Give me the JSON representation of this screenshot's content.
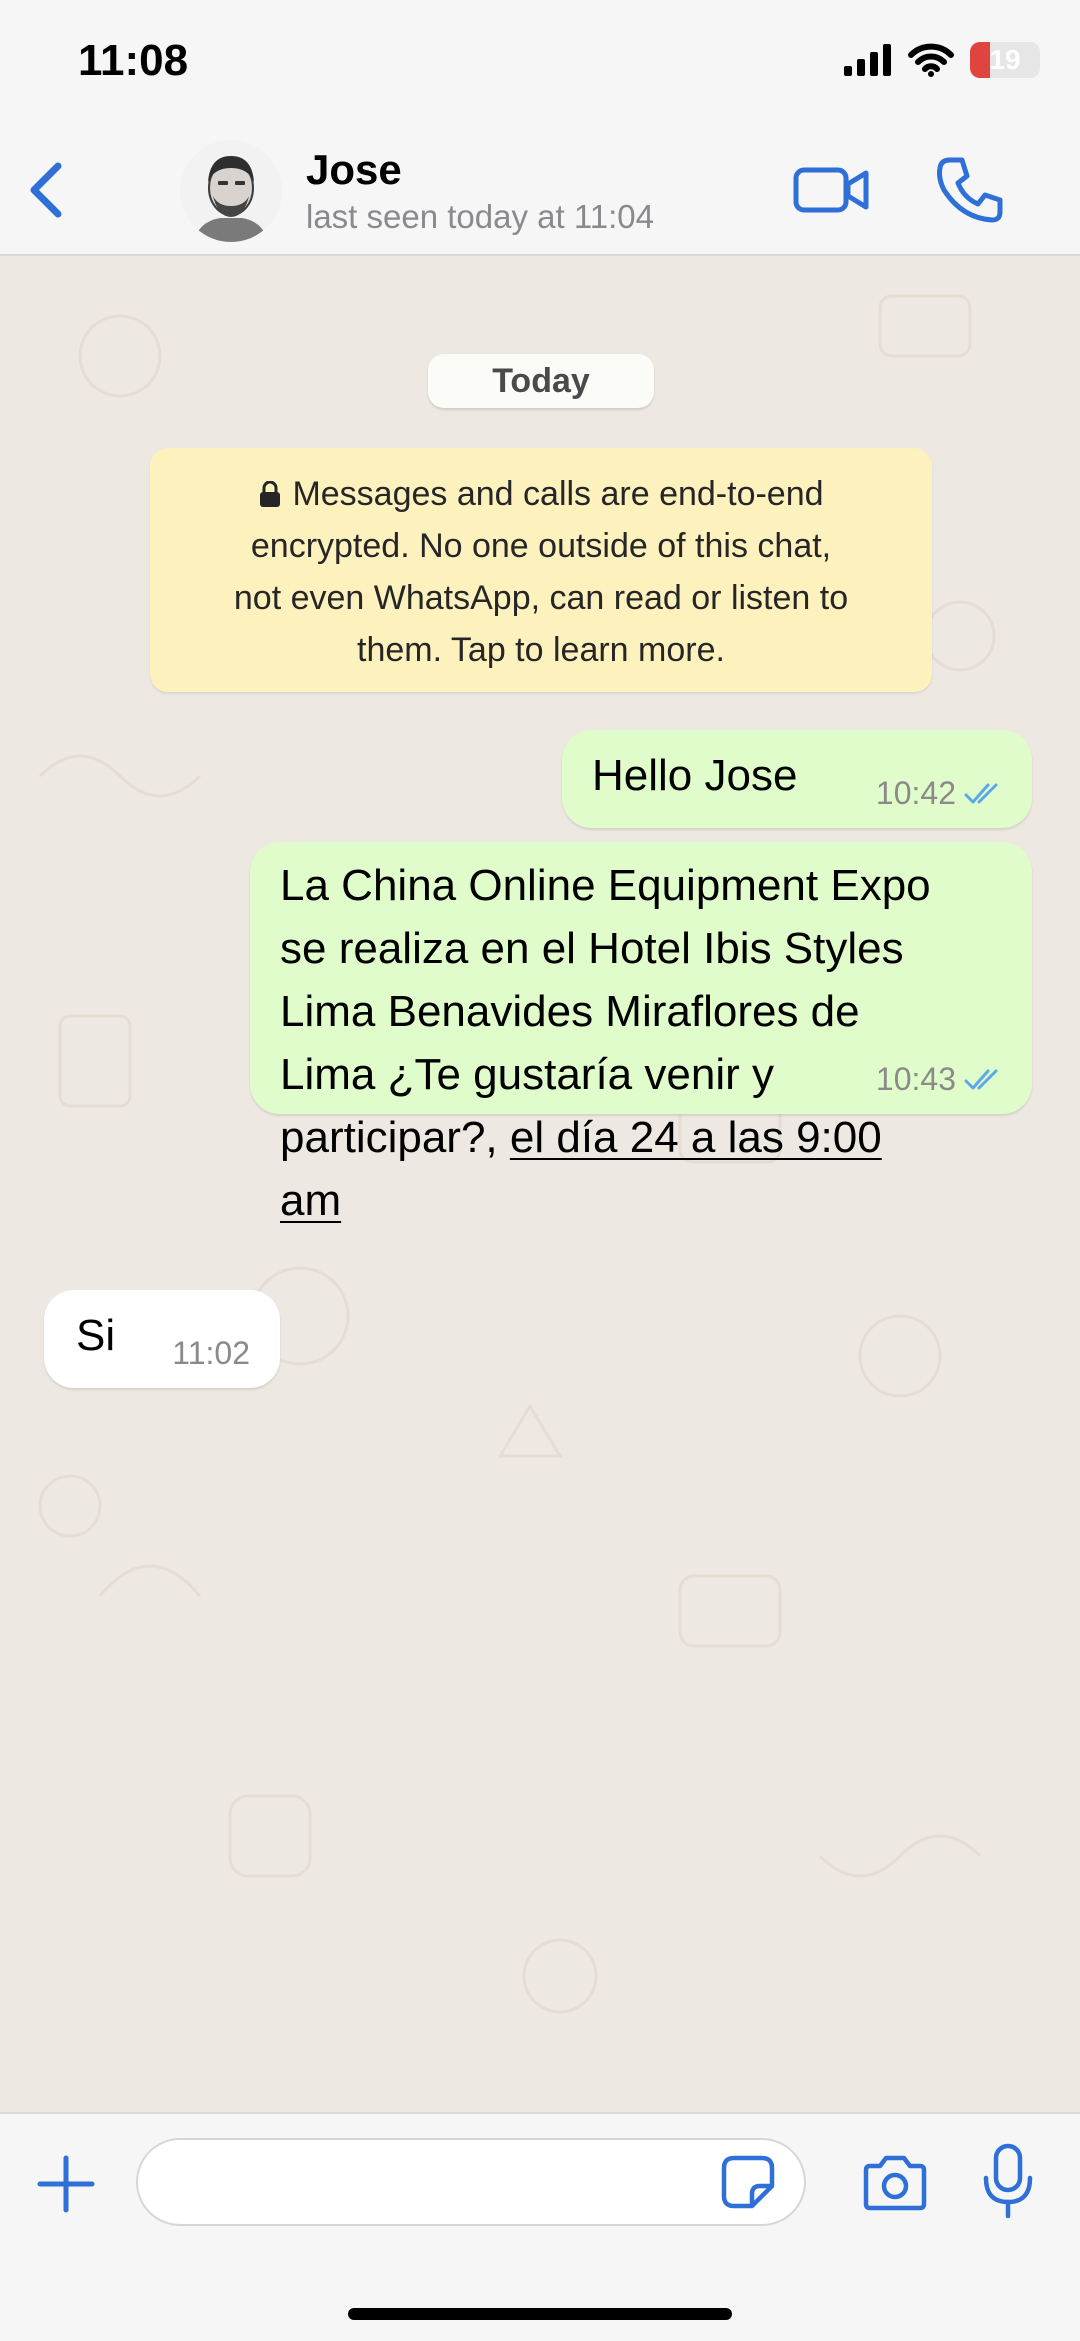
{
  "status_bar": {
    "time": "11:08",
    "battery_level": "19",
    "icons": [
      "signal-icon",
      "wifi-icon",
      "battery-icon"
    ]
  },
  "header": {
    "back_icon": "chevron-left-icon",
    "contact_name": "Jose",
    "contact_status": "last seen today at 11:04",
    "video_icon": "video-camera-icon",
    "call_icon": "phone-icon"
  },
  "chat": {
    "date_separator": "Today",
    "encryption_notice": {
      "line1": "Messages and calls are end-to-end",
      "line2": "encrypted. No one outside of this chat,",
      "line3": "not even WhatsApp, can read or listen to",
      "line4": "them. Tap to learn more."
    },
    "messages": [
      {
        "direction": "outgoing",
        "text": "Hello Jose",
        "time": "10:42",
        "status": "read"
      },
      {
        "direction": "outgoing",
        "lines": [
          "La China Online Equipment Expo",
          "se realiza en el Hotel Ibis Styles",
          "Lima Benavides Miraflores de",
          "Lima ¿Te gustaría venir y"
        ],
        "line5_plain": "participar?, ",
        "date_link_part1": "el día 24 a las 9:00",
        "date_link_part2": "am",
        "time": "10:43",
        "status": "read"
      },
      {
        "direction": "incoming",
        "text": "Si",
        "time": "11:02"
      }
    ]
  },
  "composer": {
    "placeholder": "",
    "icons": [
      "plus-icon",
      "sticker-icon",
      "camera-icon",
      "microphone-icon"
    ]
  },
  "colors": {
    "accent": "#2f6fd8",
    "outgoing_bubble": "#e1fccb",
    "incoming_bubble": "#ffffff",
    "notice_bg": "#fdf1be",
    "read_ticks": "#5aa8e8",
    "chat_bg": "#ede8e1",
    "battery_low": "#e0443e"
  }
}
